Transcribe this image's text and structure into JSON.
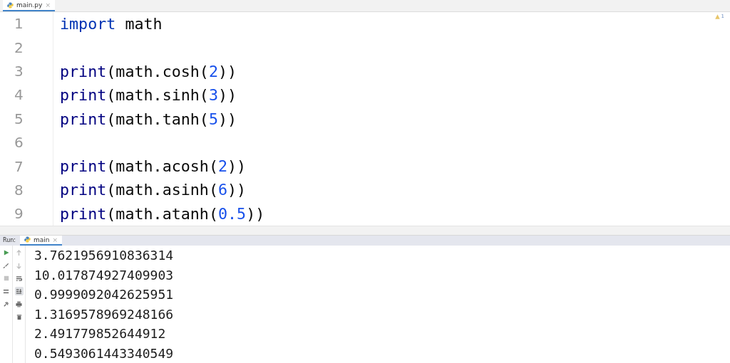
{
  "editor_tabs": [
    {
      "label": "main.py",
      "close": "×",
      "selected": true
    }
  ],
  "inspection": {
    "count": "1"
  },
  "code_lines": [
    {
      "number": "1",
      "tokens": [
        {
          "kind": "keyword",
          "text": "import"
        },
        {
          "kind": "plain",
          "text": " math"
        }
      ]
    },
    {
      "number": "2"
    },
    {
      "number": "3",
      "tokens": [
        {
          "kind": "builtin",
          "text": "print"
        },
        {
          "kind": "plain",
          "text": "(math.cosh("
        },
        {
          "kind": "number",
          "text": "2"
        },
        {
          "kind": "plain",
          "text": "))"
        }
      ]
    },
    {
      "number": "4",
      "tokens": [
        {
          "kind": "builtin",
          "text": "print"
        },
        {
          "kind": "plain",
          "text": "(math.sinh("
        },
        {
          "kind": "number",
          "text": "3"
        },
        {
          "kind": "plain",
          "text": "))"
        }
      ]
    },
    {
      "number": "5",
      "tokens": [
        {
          "kind": "builtin",
          "text": "print"
        },
        {
          "kind": "plain",
          "text": "(math.tanh("
        },
        {
          "kind": "number",
          "text": "5"
        },
        {
          "kind": "plain",
          "text": "))"
        }
      ]
    },
    {
      "number": "6"
    },
    {
      "number": "7",
      "tokens": [
        {
          "kind": "builtin",
          "text": "print"
        },
        {
          "kind": "plain",
          "text": "(math.acosh("
        },
        {
          "kind": "number",
          "text": "2"
        },
        {
          "kind": "plain",
          "text": "))"
        }
      ]
    },
    {
      "number": "8",
      "tokens": [
        {
          "kind": "builtin",
          "text": "print"
        },
        {
          "kind": "plain",
          "text": "(math.asinh("
        },
        {
          "kind": "number",
          "text": "6"
        },
        {
          "kind": "plain",
          "text": "))"
        }
      ]
    },
    {
      "number": "9",
      "tokens": [
        {
          "kind": "builtin",
          "text": "print"
        },
        {
          "kind": "plain",
          "text": "(math.atanh("
        },
        {
          "kind": "number",
          "text": "0.5"
        },
        {
          "kind": "plain",
          "text": "))"
        }
      ]
    }
  ],
  "run_panel": {
    "label": "Run:",
    "tabs": [
      {
        "label": "main",
        "close": "×",
        "selected": true
      }
    ],
    "output": [
      "3.7621956910836314",
      "10.017874927409903",
      "0.9999092042625951",
      "1.3169578969248166",
      "2.491779852644912",
      "0.5493061443340549"
    ],
    "soft_wrap_on": false,
    "scroll_to_end_on": true
  }
}
